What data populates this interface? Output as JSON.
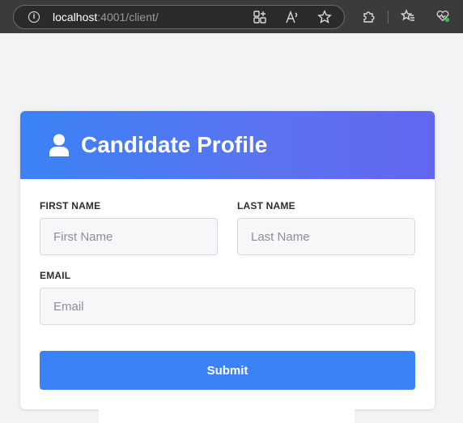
{
  "browser": {
    "url_host": "localhost",
    "url_rest": ":4001/client/",
    "icons": [
      "info-icon",
      "apps-icon",
      "read-aloud-icon",
      "favorite-star-icon",
      "extensions-icon",
      "favorites-icon",
      "health-icon"
    ]
  },
  "form": {
    "title": "Candidate Profile",
    "title_icon": "user-icon",
    "first_name_label": "FIRST NAME",
    "first_name_placeholder": "First Name",
    "last_name_label": "LAST NAME",
    "last_name_placeholder": "Last Name",
    "email_label": "EMAIL",
    "email_placeholder": "Email",
    "submit_label": "Submit"
  },
  "colors": {
    "accent": "#3b82f6",
    "header_gradient_end": "#6366f1",
    "page_background": "#f2f3f5"
  }
}
